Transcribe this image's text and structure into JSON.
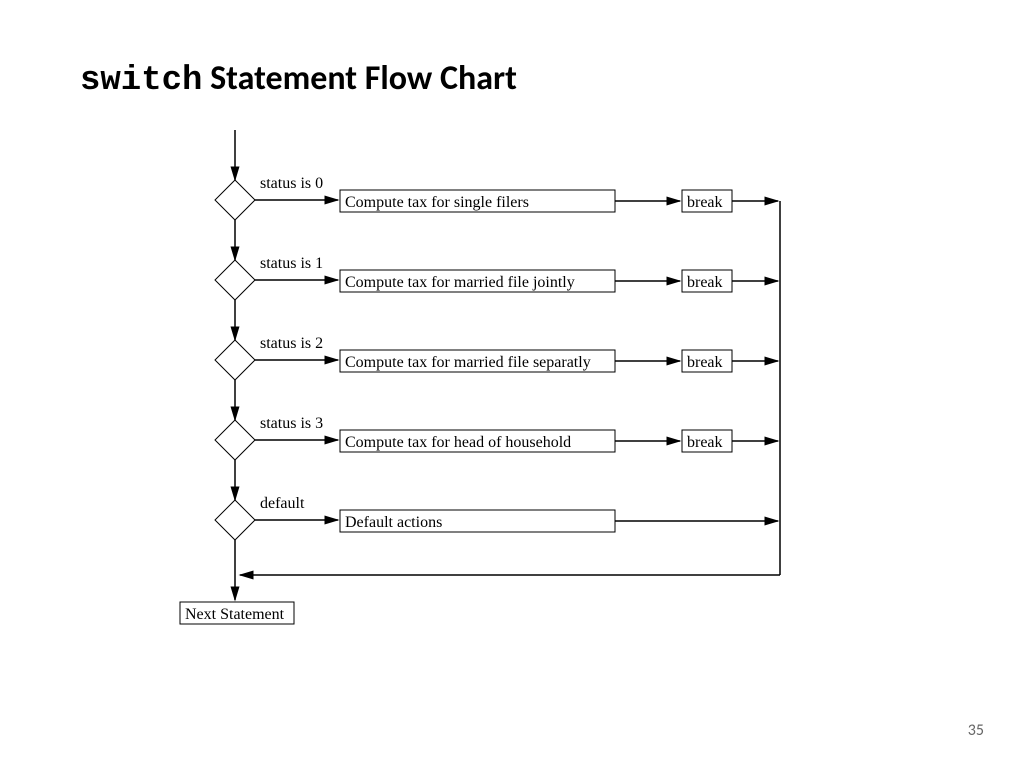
{
  "title": {
    "code": "switch",
    "rest": " Statement Flow Chart"
  },
  "page_number": "35",
  "diagram": {
    "branches": [
      {
        "condition": "status is 0",
        "process": "Compute tax for single filers",
        "exit": "break"
      },
      {
        "condition": "status is 1",
        "process": "Compute tax for married file jointly",
        "exit": "break"
      },
      {
        "condition": "status is 2",
        "process": "Compute tax for married file separatly",
        "exit": "break"
      },
      {
        "condition": "status is 3",
        "process": "Compute tax for head of household",
        "exit": "break"
      },
      {
        "condition": "default",
        "process": "Default actions",
        "exit": ""
      }
    ],
    "end": "Next Statement"
  }
}
